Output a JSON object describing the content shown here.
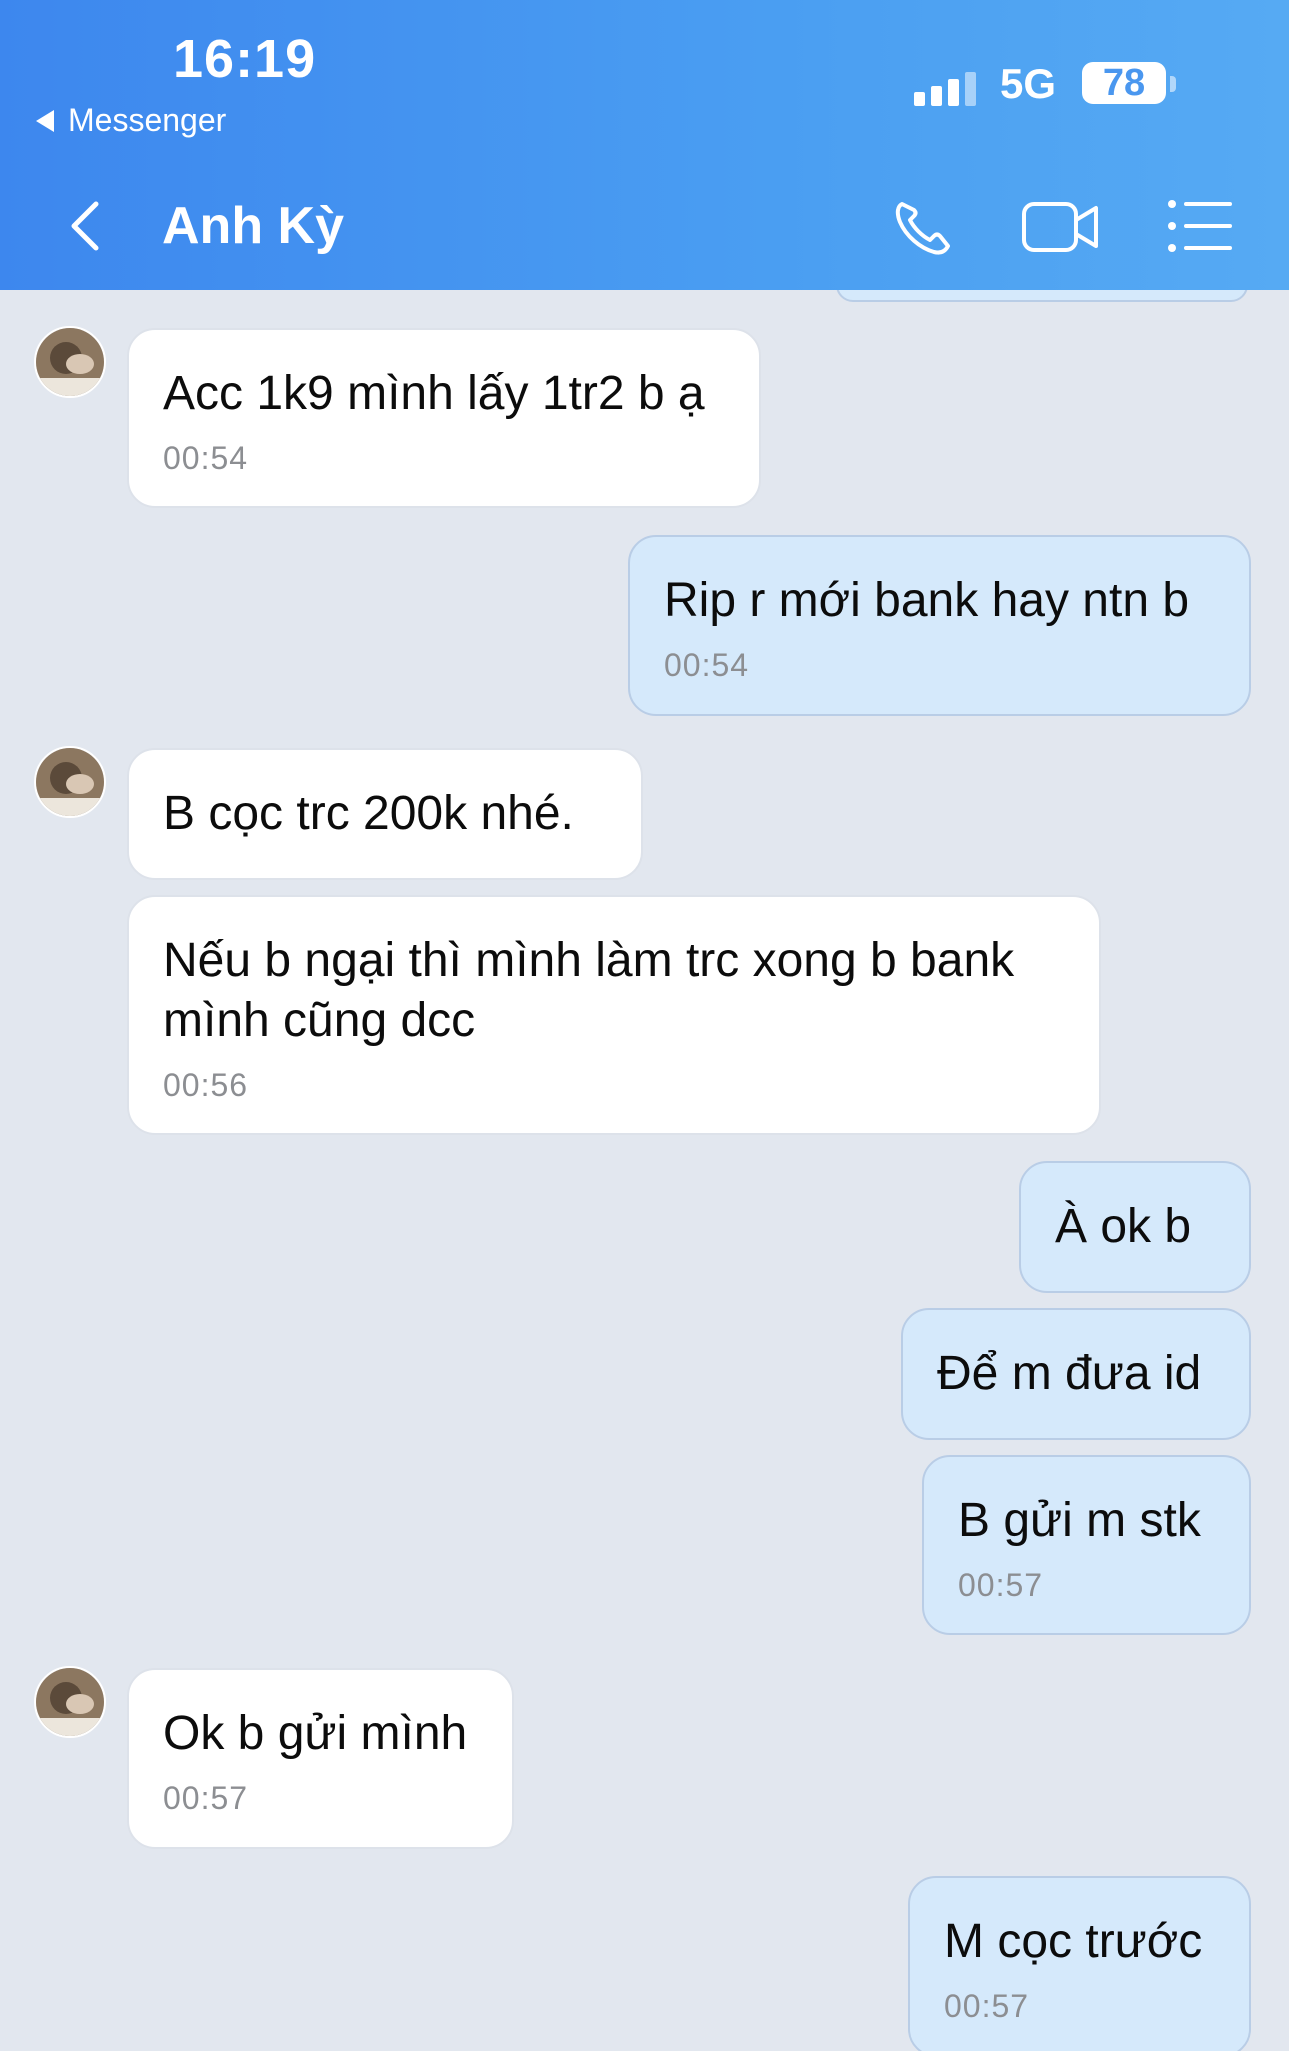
{
  "status_bar": {
    "time": "16:19",
    "back_app": "Messenger",
    "network": "5G",
    "battery": "78"
  },
  "header": {
    "title": "Anh Kỳ",
    "icons": [
      "back-chevron-icon",
      "phone-icon",
      "video-camera-icon",
      "list-menu-icon"
    ]
  },
  "colors": {
    "header_start": "#3d87ee",
    "header_end": "#56aaf3",
    "chat_bg": "#e2e7ef",
    "incoming_bubble": "#ffffff",
    "outgoing_bubble": "#d5e9fb"
  },
  "messages": [
    {
      "sender": "them",
      "text": "Acc 1k9 mình lấy 1tr2 b ạ",
      "time": "00:54"
    },
    {
      "sender": "me",
      "text": "Rip r mới bank hay ntn b",
      "time": "00:54"
    },
    {
      "sender": "them",
      "text": "B cọc trc 200k nhé.",
      "time": ""
    },
    {
      "sender": "them",
      "text": "Nếu b ngại thì mình làm trc xong b bank\nmình cũng dcc",
      "time": "00:56"
    },
    {
      "sender": "me",
      "text": "À ok b",
      "time": ""
    },
    {
      "sender": "me",
      "text": "Để m đưa id",
      "time": ""
    },
    {
      "sender": "me",
      "text": "B gửi m stk",
      "time": "00:57"
    },
    {
      "sender": "them",
      "text": "Ok b gửi mình",
      "time": "00:57"
    },
    {
      "sender": "me",
      "text": "M cọc trước",
      "time": "00:57"
    }
  ]
}
